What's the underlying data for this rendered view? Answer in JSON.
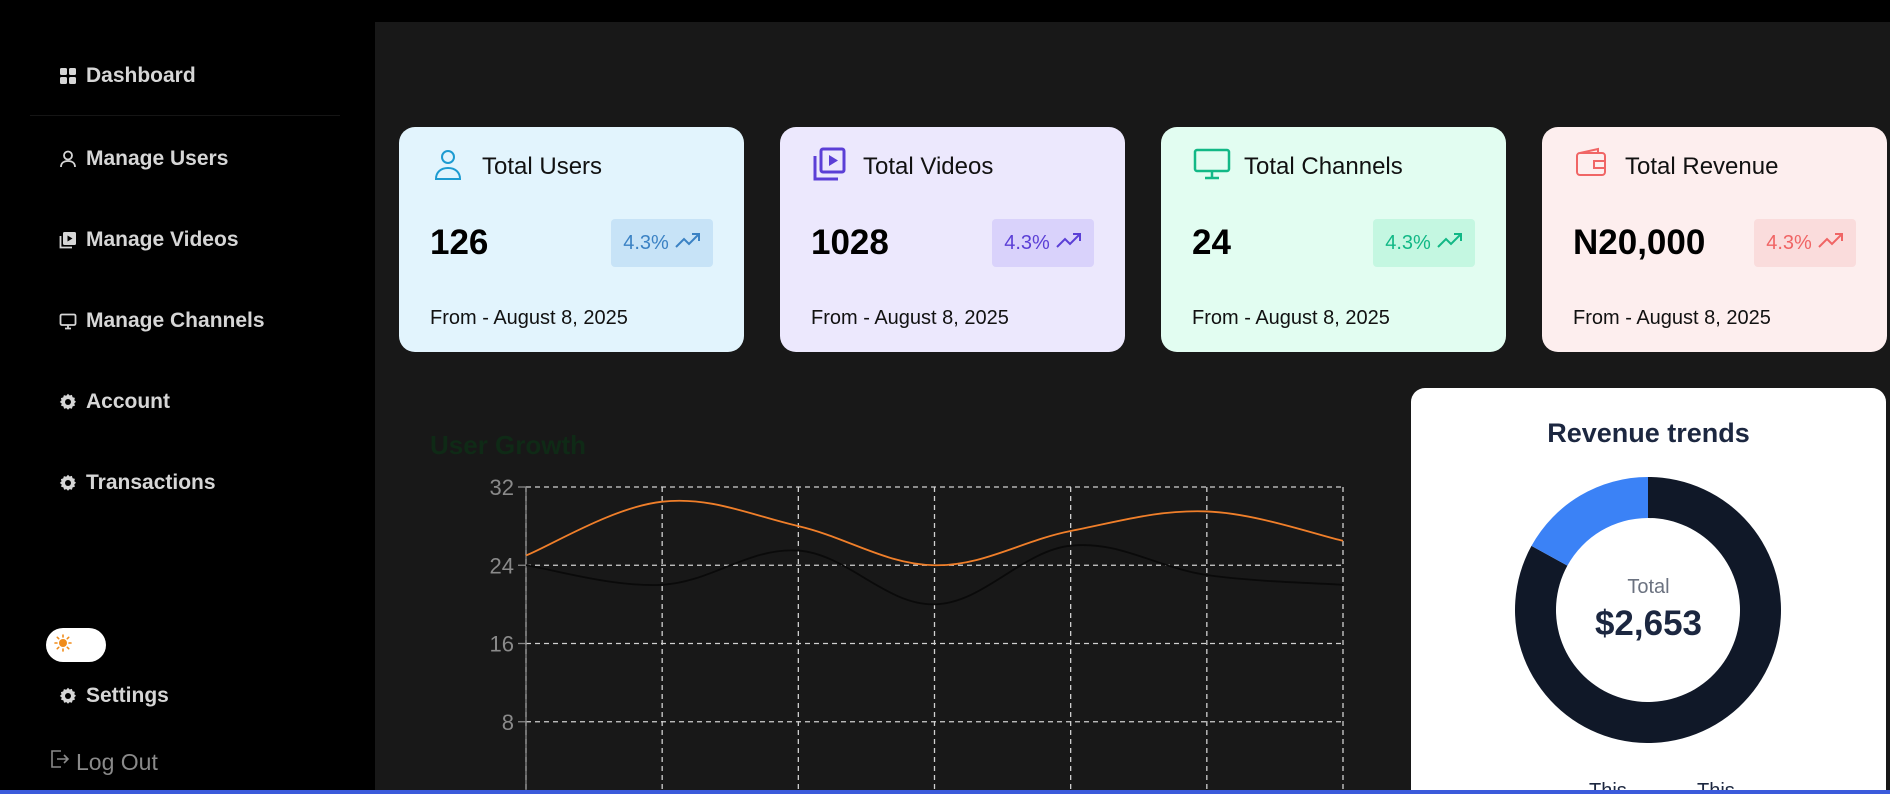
{
  "sidebar": {
    "items": [
      {
        "label": "Dashboard",
        "icon": "grid-icon"
      },
      {
        "label": "Manage Users",
        "icon": "user-icon"
      },
      {
        "label": "Manage Videos",
        "icon": "video-icon"
      },
      {
        "label": "Manage Channels",
        "icon": "monitor-icon"
      },
      {
        "label": "Account",
        "icon": "gear-icon"
      },
      {
        "label": "Transactions",
        "icon": "gear-icon"
      }
    ],
    "settings_label": "Settings",
    "logout_label": "Log Out",
    "theme_icon": "sun-icon"
  },
  "cards": [
    {
      "title": "Total Users",
      "value": "126",
      "change": "4.3%",
      "footer": "From - August 8, 2025",
      "icon": "user-icon",
      "bg": "#e2f4fd",
      "accent": "#3b82c4",
      "badge_bg": "#c7e3f7"
    },
    {
      "title": "Total Videos",
      "value": "1028",
      "change": "4.3%",
      "footer": "From - August 8, 2025",
      "icon": "video-icon",
      "bg": "#ece8fd",
      "accent": "#5b3fd6",
      "badge_bg": "#d9d2fb"
    },
    {
      "title": "Total Channels",
      "value": "24",
      "change": "4.3%",
      "footer": "From - August 8, 2025",
      "icon": "monitor-icon",
      "bg": "#e2fdf1",
      "accent": "#12b886",
      "badge_bg": "#c4f7e1"
    },
    {
      "title": "Total Revenue",
      "value": "N20,000",
      "change": "4.3%",
      "footer": "From - August 8, 2025",
      "icon": "wallet-icon",
      "bg": "#fdeeee",
      "accent": "#f06565",
      "badge_bg": "#fadcdc"
    }
  ],
  "user_growth": {
    "title": "User Growth"
  },
  "chart_data": {
    "type": "line",
    "title": "User Growth",
    "x": [
      0,
      1,
      2,
      3,
      4,
      5,
      6
    ],
    "ylim": [
      0,
      32
    ],
    "yticks": [
      8,
      16,
      24,
      32
    ],
    "grid": true,
    "series": [
      {
        "values": [
          25,
          30.5,
          28,
          24,
          27.5,
          29.5,
          26.5
        ],
        "color": "#f07f2a"
      },
      {
        "values": [
          24,
          22,
          25.5,
          20,
          26,
          23,
          22
        ],
        "color": "#0a0a0a"
      }
    ]
  },
  "revenue": {
    "title": "Revenue trends",
    "total_label": "Total",
    "total_value": "$2,653",
    "legend": [
      "This",
      "This"
    ],
    "chart_data": {
      "type": "pie",
      "values": [
        83,
        17
      ],
      "colors": [
        "#101828",
        "#3b82f6"
      ]
    }
  }
}
